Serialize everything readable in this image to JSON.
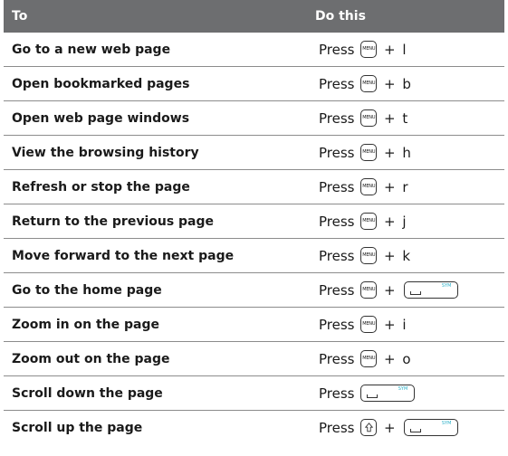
{
  "table": {
    "headers": {
      "task": "To",
      "action": "Do this"
    },
    "press_label": "Press",
    "plus_label": "+",
    "menu_key_label": "MENU",
    "sym_key_label": "SYM",
    "rows": [
      {
        "task": "Go to a new web page",
        "letter": "l"
      },
      {
        "task": "Open bookmarked pages",
        "letter": "b"
      },
      {
        "task": "Open web page windows",
        "letter": "t"
      },
      {
        "task": "View the browsing history",
        "letter": "h"
      },
      {
        "task": "Refresh or stop the page",
        "letter": "r"
      },
      {
        "task": "Return to the previous page",
        "letter": "j"
      },
      {
        "task": "Move forward to the next page",
        "letter": "k"
      },
      {
        "task": "Go to the home page"
      },
      {
        "task": "Zoom in on the page",
        "letter": "i"
      },
      {
        "task": "Zoom out on the page",
        "letter": "o"
      },
      {
        "task": "Scroll down the page"
      },
      {
        "task": "Scroll up the page"
      }
    ]
  }
}
